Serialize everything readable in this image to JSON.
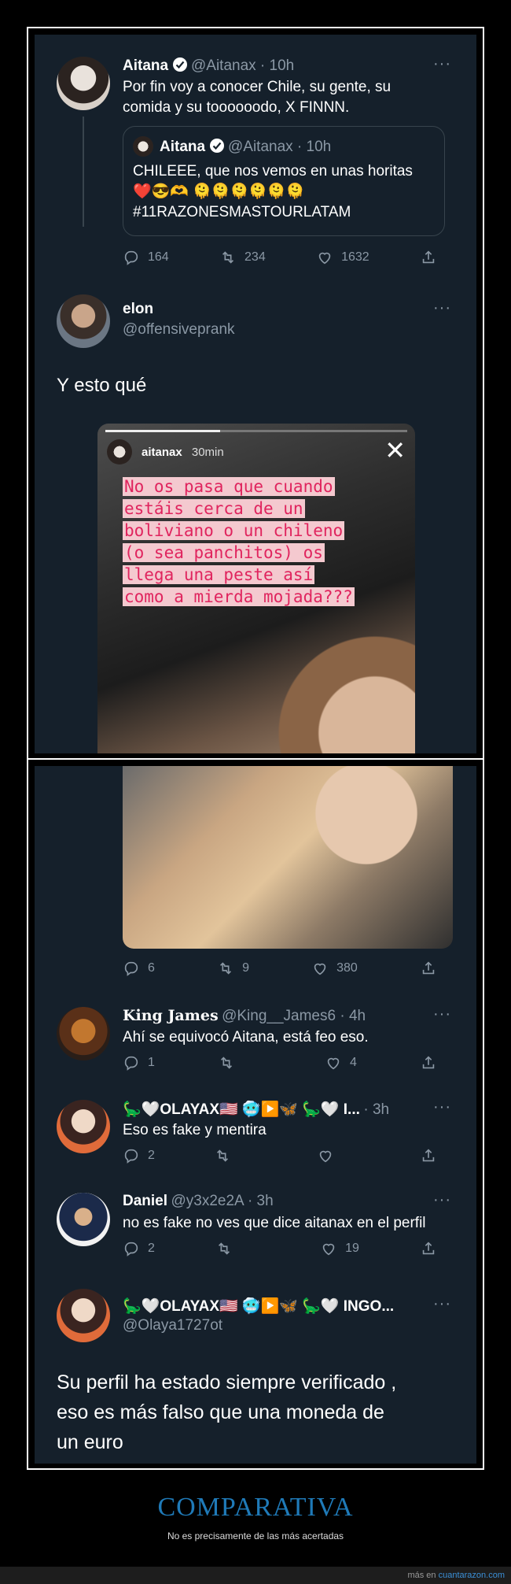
{
  "tweet1": {
    "name": "Aitana",
    "handle": "@Aitanax · 10h",
    "text_line1": "Por fin voy a conocer Chile, su gente, su",
    "text_line2": "comida y su toooooodo, X FINNN.",
    "quote": {
      "name": "Aitana",
      "handle": "@Aitanax · 10h",
      "line1": "CHILEEE, que nos vemos en unas horitas",
      "emojis": "❤️😎🫶 🫠🫠🫠🫠🫠🫠",
      "line3": "#11RAZONESMASTOURLATAM"
    },
    "replies": "164",
    "retweets": "234",
    "likes": "1632"
  },
  "tweet2": {
    "name": "elon",
    "handle": "@offensiveprank",
    "text": "Y esto qué",
    "story": {
      "user": "aitanax",
      "time": "30min",
      "lines": [
        "No os pasa que cuando",
        "estáis cerca de un",
        "boliviano o un chileno",
        "(o sea panchitos) os",
        "llega una peste así",
        "como a mierda mojada???"
      ]
    },
    "replies": "6",
    "retweets": "9",
    "likes": "380"
  },
  "reply1": {
    "name": "King James",
    "handle": "@King__James6 · 4h",
    "text": "Ahí se equivocó Aitana, está feo eso.",
    "replies": "1",
    "retweets": "",
    "likes": "4"
  },
  "reply2": {
    "name": "🦕🤍OLAYAX🇺🇸 🥶▶️🦋 🦕🤍 I...",
    "handle": "· 3h",
    "text": "Eso es fake y mentira",
    "replies": "2",
    "retweets": "",
    "likes": ""
  },
  "reply3": {
    "name": "Daniel",
    "handle": "@y3x2e2A · 3h",
    "text": "no es fake no ves que dice aitanax en el perfil",
    "replies": "2",
    "retweets": "",
    "likes": "19"
  },
  "tweet3": {
    "name": "🦕🤍OLAYAX🇺🇸 🥶▶️🦋 🦕🤍 INGO...",
    "handle": "@Olaya1727ot",
    "line1": "Su perfil ha estado siempre verificado ,",
    "line2": "eso es más falso que una moneda de",
    "line3": "un euro"
  },
  "footer": {
    "title": "COMPARATIVA",
    "subtitle": "No es precisamente de las más acertadas",
    "more_prefix": "más en ",
    "more_link": "cuantarazon.com"
  },
  "colors": {
    "bg": "#15202b",
    "muted": "#8b98a5",
    "verified": "#ffffff",
    "accent": "#1f7ab8"
  }
}
